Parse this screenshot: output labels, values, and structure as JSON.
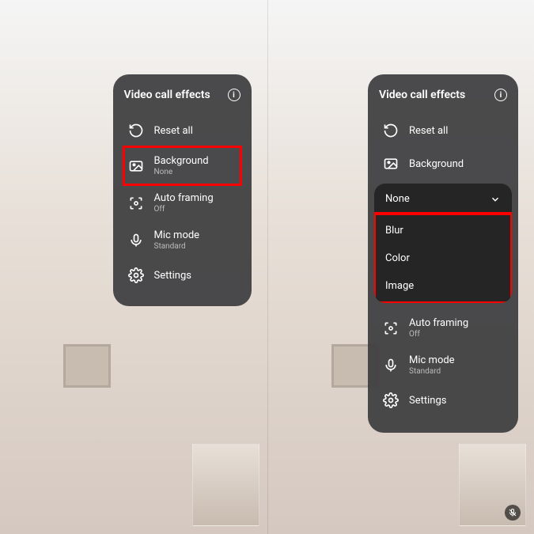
{
  "panel": {
    "title": "Video call effects",
    "reset_label": "Reset all",
    "background_label": "Background",
    "background_value": "None",
    "autoframing_label": "Auto framing",
    "autoframing_value": "Off",
    "micmode_label": "Mic mode",
    "micmode_value": "Standard",
    "settings_label": "Settings"
  },
  "submenu": {
    "selected": "None",
    "options": {
      "blur": "Blur",
      "color": "Color",
      "image": "Image"
    }
  }
}
